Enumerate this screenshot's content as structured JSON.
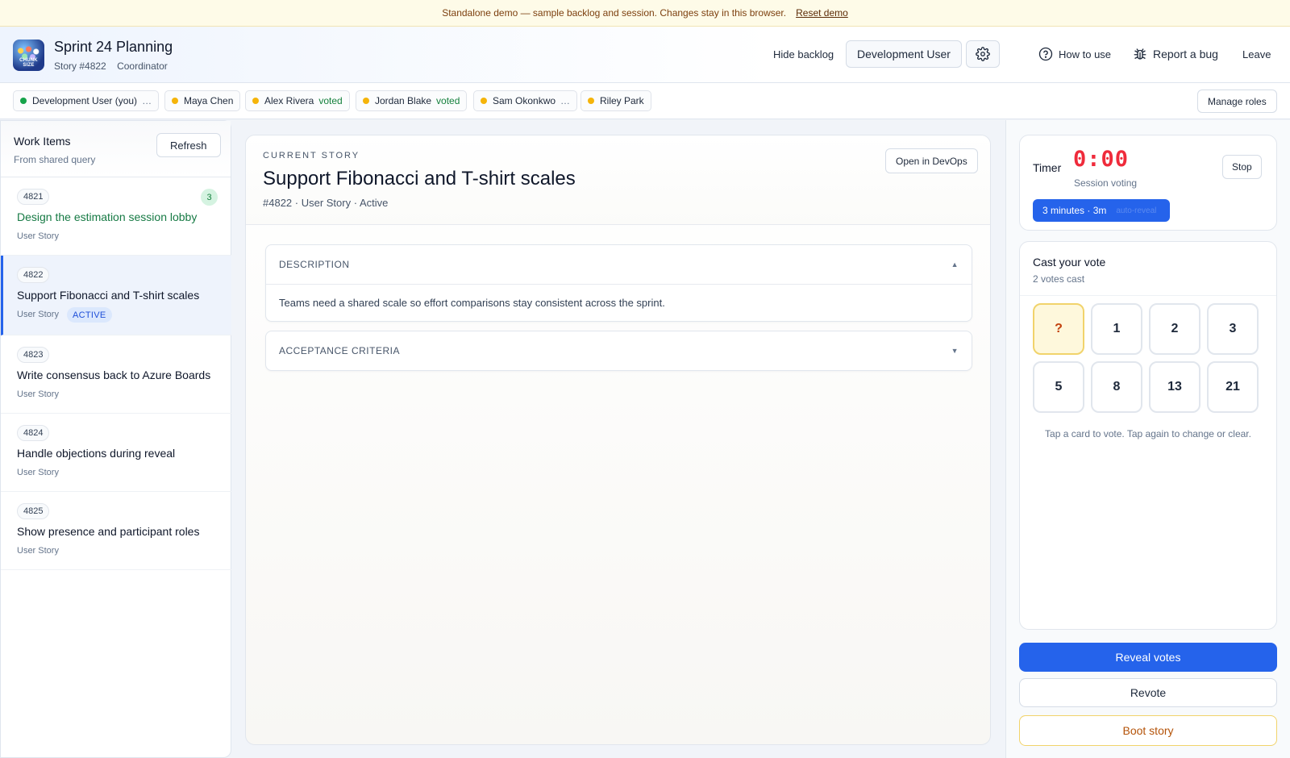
{
  "banner": {
    "text": "Standalone demo — sample backlog and session. Changes stay in this browser.",
    "reset_label": "Reset demo"
  },
  "header": {
    "logo_text": "CHUNK SIZE",
    "title": "Sprint 24 Planning",
    "story_ref": "Story #4822",
    "role": "Coordinator",
    "hide_backlog": "Hide backlog",
    "user_name": "Development User",
    "how_to_use": "How to use",
    "report_bug": "Report a bug",
    "leave": "Leave"
  },
  "participants": [
    {
      "name": "Development User (you)",
      "status": "",
      "extra": "…",
      "dot": "#16a34a"
    },
    {
      "name": "Maya Chen",
      "status": "",
      "extra": "",
      "dot": "#f5b40a"
    },
    {
      "name": "Alex Rivera",
      "status": "voted",
      "extra": "",
      "dot": "#f5b40a"
    },
    {
      "name": "Jordan Blake",
      "status": "voted",
      "extra": "",
      "dot": "#f5b40a"
    },
    {
      "name": "Sam Okonkwo",
      "status": "",
      "extra": "…",
      "dot": "#f5b40a"
    },
    {
      "name": "Riley Park",
      "status": "",
      "extra": "",
      "dot": "#f5b40a"
    }
  ],
  "manage_roles": "Manage roles",
  "work_items": {
    "title": "Work Items",
    "subtitle": "From shared query",
    "refresh": "Refresh",
    "items": [
      {
        "id": "4821",
        "title": "Design the estimation session lobby",
        "type": "User Story",
        "count": "3"
      },
      {
        "id": "4822",
        "title": "Support Fibonacci and T-shirt scales",
        "type": "User Story",
        "state": "ACTIVE"
      },
      {
        "id": "4823",
        "title": "Write consensus back to Azure Boards",
        "type": "User Story"
      },
      {
        "id": "4824",
        "title": "Handle objections during reveal",
        "type": "User Story"
      },
      {
        "id": "4825",
        "title": "Show presence and participant roles",
        "type": "User Story"
      }
    ]
  },
  "story": {
    "kicker": "CURRENT STORY",
    "title": "Support Fibonacci and T-shirt scales",
    "meta": "#4822 · User Story · Active",
    "open_devops": "Open in DevOps",
    "description_label": "DESCRIPTION",
    "description_text": "Teams need a shared scale so effort comparisons stay consistent across the sprint.",
    "acceptance_label": "ACCEPTANCE CRITERIA"
  },
  "timer": {
    "label": "Timer",
    "value": "0:00",
    "sub": "Session voting",
    "stop": "Stop",
    "duration": "3 minutes · 3m",
    "auto": "auto-reveal"
  },
  "vote": {
    "title": "Cast your vote",
    "sub": "2 votes cast",
    "cards": [
      "?",
      "1",
      "2",
      "3",
      "5",
      "8",
      "13",
      "21"
    ],
    "hint": "Tap a card to vote. Tap again to change or clear."
  },
  "actions": {
    "reveal": "Reveal votes",
    "revote": "Revote",
    "boot": "Boot story"
  },
  "colors": {
    "accent": "#2563eb",
    "timer": "#ef2b3b",
    "voted": "#15803d"
  }
}
